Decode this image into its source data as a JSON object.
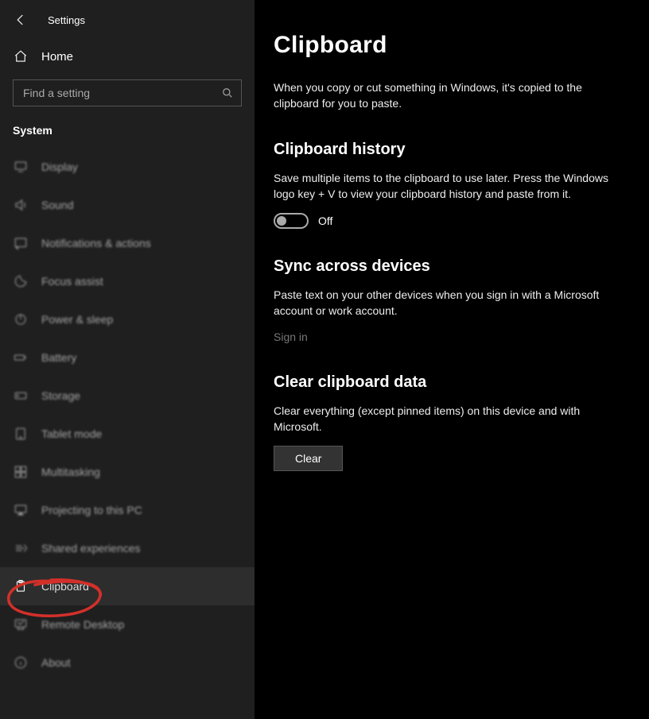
{
  "app": {
    "title": "Settings"
  },
  "sidebar": {
    "home_label": "Home",
    "search_placeholder": "Find a setting",
    "section_label": "System",
    "items": [
      {
        "label": "Display"
      },
      {
        "label": "Sound"
      },
      {
        "label": "Notifications & actions"
      },
      {
        "label": "Focus assist"
      },
      {
        "label": "Power & sleep"
      },
      {
        "label": "Battery"
      },
      {
        "label": "Storage"
      },
      {
        "label": "Tablet mode"
      },
      {
        "label": "Multitasking"
      },
      {
        "label": "Projecting to this PC"
      },
      {
        "label": "Shared experiences"
      },
      {
        "label": "Clipboard"
      },
      {
        "label": "Remote Desktop"
      },
      {
        "label": "About"
      }
    ],
    "active_index": 11
  },
  "main": {
    "title": "Clipboard",
    "intro": "When you copy or cut something in Windows, it's copied to the clipboard for you to paste.",
    "history": {
      "heading": "Clipboard history",
      "body": "Save multiple items to the clipboard to use later. Press the Windows logo key + V to view your clipboard history and paste from it.",
      "toggle_state": "Off"
    },
    "sync": {
      "heading": "Sync across devices",
      "body": "Paste text on your other devices when you sign in with a Microsoft account or work account.",
      "signin_label": "Sign in"
    },
    "clear": {
      "heading": "Clear clipboard data",
      "body": "Clear everything (except pinned items) on this device and with Microsoft.",
      "button_label": "Clear"
    }
  }
}
